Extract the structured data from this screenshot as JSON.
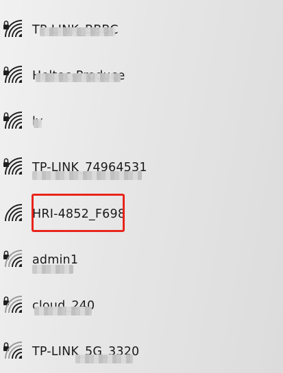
{
  "networks": [
    {
      "ssid": "TP-LINK_BBBC",
      "secured": true
    },
    {
      "ssid": "Heltec-Produce",
      "secured": true
    },
    {
      "ssid": "ly",
      "secured": true
    },
    {
      "ssid": "TP-LINK_74964531",
      "secured": true
    },
    {
      "ssid": "HRI-4852_F698",
      "secured": false
    },
    {
      "ssid": "admin1",
      "secured": true
    },
    {
      "ssid": "cloud_240",
      "secured": true
    },
    {
      "ssid": "TP-LINK_5G_3320",
      "secured": true
    }
  ],
  "icons": {
    "wifi": "wifi-signal-icon",
    "lock": "lock-icon"
  },
  "colors": {
    "highlight": "#e8241b",
    "icon": "#1f1f1f",
    "icon_dim": "#9a9a9a"
  }
}
